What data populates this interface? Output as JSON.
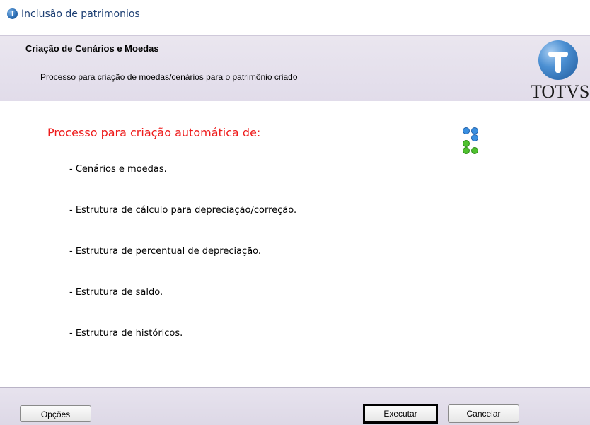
{
  "window": {
    "title": "Inclusão de patrimonios"
  },
  "header": {
    "title": "Criação de Cenários e Moedas",
    "subtitle": "Processo para criação de moedas/cenários para o patrimônio criado",
    "logo_text": "TOTVS"
  },
  "content": {
    "heading": "Processo para criação automática de:",
    "items": [
      "- Cenários e moedas.",
      "- Estrutura de cálculo para depreciação/correção.",
      "- Estrutura de percentual de depreciação.",
      "- Estrutura de saldo.",
      "- Estrutura de históricos."
    ],
    "icon": "wizard-process-icon"
  },
  "footer": {
    "opcoes_label": "Opções",
    "executar_label": "Executar",
    "cancelar_label": "Cancelar"
  },
  "colors": {
    "heading": "#ee1c1c",
    "header_bg": "#e6e2ec",
    "footer_bg": "#e2dee9",
    "title_text": "#1d3f73"
  }
}
